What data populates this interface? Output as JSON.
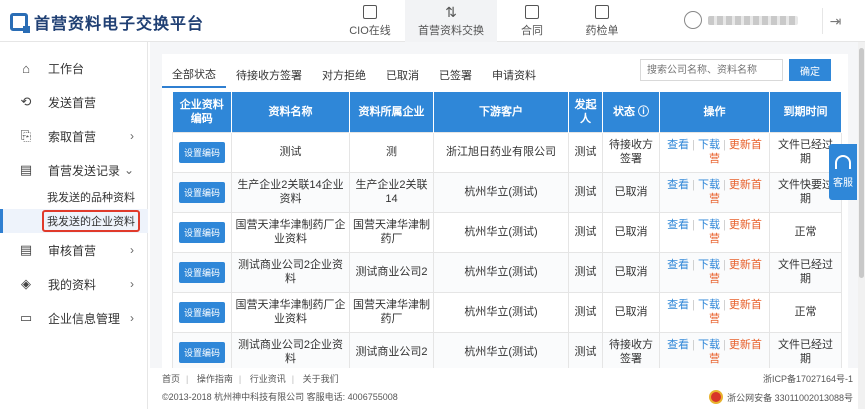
{
  "app": {
    "title": "首营资料电子交换平台",
    "nav": [
      {
        "label": "CIO在线",
        "icon": "document-icon"
      },
      {
        "label": "首营资料交换",
        "icon": "exchange-arrows-icon"
      },
      {
        "label": "合同",
        "icon": "contract-icon"
      },
      {
        "label": "药检单",
        "icon": "report-icon"
      }
    ],
    "logout_glyph": "⇥"
  },
  "sidebar": {
    "items": [
      {
        "label": "工作台",
        "glyph": "⌂"
      },
      {
        "label": "发送首营",
        "glyph": "⟲"
      },
      {
        "label": "索取首营",
        "glyph": "⎘"
      },
      {
        "label": "首营发送记录",
        "glyph": "▤"
      },
      {
        "label": "审核首营",
        "glyph": "▤"
      },
      {
        "label": "我的资料",
        "glyph": "◈"
      },
      {
        "label": "企业信息管理",
        "glyph": "▭"
      }
    ],
    "subitems": [
      "我发送的品种资料",
      "我发送的企业资料"
    ]
  },
  "tabs": [
    "全部状态",
    "待接收方签署",
    "对方拒绝",
    "已取消",
    "已签署",
    "申请资料"
  ],
  "search": {
    "placeholder": "搜索公司名称、资料名称",
    "button": "确定"
  },
  "table": {
    "columns": [
      "企业资料编码",
      "资料名称",
      "资料所属企业",
      "下游客户",
      "发起人",
      "状态",
      "操作",
      "到期时间"
    ],
    "code_button": "设置编码",
    "ops": {
      "view": "查看",
      "download": "下载",
      "update": "更新首营"
    },
    "rows": [
      {
        "name": "测试",
        "company": "测",
        "customer": "浙江旭日药业有限公司",
        "initiator": "测试",
        "status": "待接收方签署",
        "expiry": "文件已经过期"
      },
      {
        "name": "生产企业2关联14企业资料",
        "company": "生产企业2关联14",
        "customer": "杭州华立(测试)",
        "initiator": "测试",
        "status": "已取消",
        "expiry": "文件快要过期"
      },
      {
        "name": "国营天津华津制药厂企业资料",
        "company": "国营天津华津制药厂",
        "customer": "杭州华立(测试)",
        "initiator": "测试",
        "status": "已取消",
        "expiry": "正常"
      },
      {
        "name": "测试商业公司2企业资料",
        "company": "测试商业公司2",
        "customer": "杭州华立(测试)",
        "initiator": "测试",
        "status": "已取消",
        "expiry": "文件已经过期"
      },
      {
        "name": "国营天津华津制药厂企业资料",
        "company": "国营天津华津制药厂",
        "customer": "杭州华立(测试)",
        "initiator": "测试",
        "status": "已取消",
        "expiry": "正常"
      },
      {
        "name": "测试商业公司2企业资料",
        "company": "测试商业公司2",
        "customer": "杭州华立(测试)",
        "initiator": "测试",
        "status": "待接收方签署",
        "expiry": "文件已经过期"
      }
    ]
  },
  "footer": {
    "links": [
      "首页",
      "操作指南",
      "行业资讯",
      "关于我们"
    ],
    "copyright": "©2013-2018  杭州神中科技有限公司  客服电话: 4006755008",
    "icp": "浙ICP备17027164号-1",
    "police": "浙公网安备 33011002013088号"
  },
  "service": {
    "label": "客服"
  },
  "colors": {
    "accent": "#2f87d8",
    "warning": "#e8612c",
    "highlight": "#e03a2b"
  }
}
